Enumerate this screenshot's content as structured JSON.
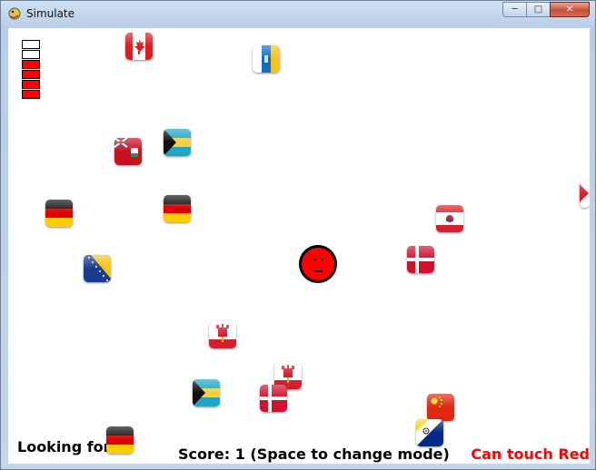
{
  "window": {
    "title": "Simulate",
    "minimize_glyph": "─",
    "maximize_glyph": "□",
    "close_glyph": "✕",
    "app_icon": "snake-icon"
  },
  "lives": {
    "filled_color": "#ff0000",
    "empty_color": "#ffffff",
    "slots": [
      {
        "filled": false
      },
      {
        "filled": false
      },
      {
        "filled": true
      },
      {
        "filled": true
      },
      {
        "filled": true
      },
      {
        "filled": true
      }
    ]
  },
  "player": {
    "color": "#ff0000",
    "face": "neutral-face"
  },
  "flags": [
    {
      "country": "canada"
    },
    {
      "country": "canary-islands"
    },
    {
      "country": "bermuda"
    },
    {
      "country": "bahamas"
    },
    {
      "country": "germany"
    },
    {
      "country": "germany"
    },
    {
      "country": "french-polynesia"
    },
    {
      "country": "denmark"
    },
    {
      "country": "bosnia-herzegovina"
    },
    {
      "country": "gibraltar"
    },
    {
      "country": "gibraltar"
    },
    {
      "country": "bahamas"
    },
    {
      "country": "denmark"
    },
    {
      "country": "china"
    },
    {
      "country": "bonaire"
    },
    {
      "country": "partial-flag-edge"
    }
  ],
  "hud": {
    "looking_for_label": "Looking for:",
    "target_flag": "germany",
    "score_text": "Score: 1 (Space to change mode)",
    "mode_text": "Can touch Red",
    "mode_color": "#ff0000"
  }
}
